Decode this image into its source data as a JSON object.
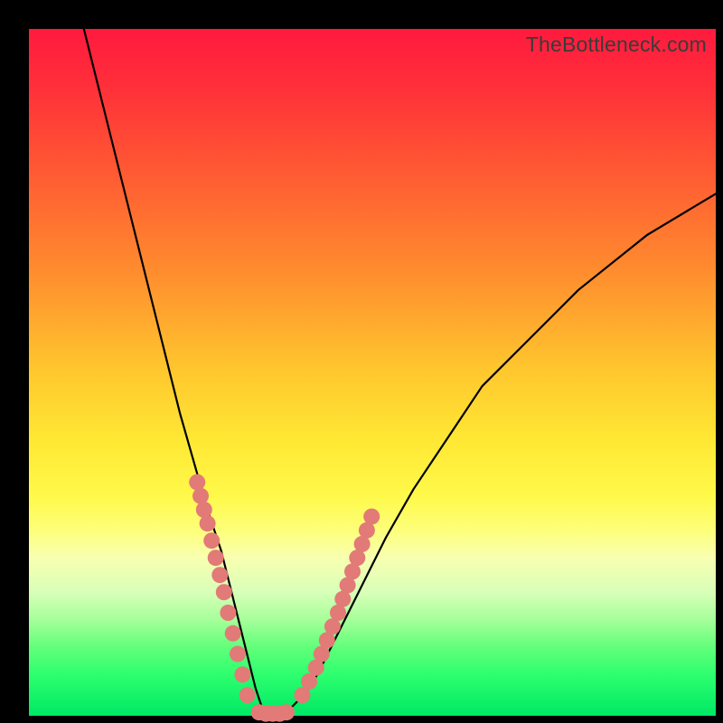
{
  "watermark": "TheBottleneck.com",
  "chart_data": {
    "type": "line",
    "title": "",
    "xlabel": "",
    "ylabel": "",
    "xlim": [
      0,
      100
    ],
    "ylim": [
      0,
      100
    ],
    "grid": false,
    "series": [
      {
        "name": "curve",
        "stroke": "#000000",
        "x": [
          8,
          10,
          12,
          14,
          16,
          18,
          20,
          22,
          24,
          26,
          27,
          28,
          29,
          30,
          31,
          32,
          33,
          34,
          35,
          36,
          37,
          38,
          40,
          42,
          44,
          46,
          48,
          52,
          56,
          60,
          66,
          72,
          80,
          90,
          100
        ],
        "y": [
          100,
          92,
          84,
          76,
          68,
          60,
          52,
          44,
          37,
          30,
          27,
          24,
          20,
          16,
          12,
          8,
          4,
          1,
          0,
          0,
          0,
          1,
          3,
          6,
          10,
          14,
          18,
          26,
          33,
          39,
          48,
          54,
          62,
          70,
          76
        ]
      },
      {
        "name": "good-zone-markers-left",
        "stroke": "#e27a77",
        "style": "dotted-thick",
        "x": [
          24.5,
          25,
          25.5,
          26,
          26.6,
          27.2,
          27.8,
          28.4,
          29,
          29.7,
          30.4,
          31.1,
          31.8
        ],
        "y": [
          34,
          32,
          30,
          28,
          25.5,
          23,
          20.5,
          18,
          15,
          12,
          9,
          6,
          3
        ]
      },
      {
        "name": "good-zone-markers-bottom",
        "stroke": "#e27a77",
        "style": "dotted-thick",
        "x": [
          33.5,
          34.5,
          35.5,
          36.5,
          37.5
        ],
        "y": [
          0.5,
          0.3,
          0.3,
          0.3,
          0.5
        ]
      },
      {
        "name": "good-zone-markers-right",
        "stroke": "#e27a77",
        "style": "dotted-thick",
        "x": [
          39.8,
          40.8,
          41.8,
          42.6,
          43.4,
          44.2,
          45,
          45.7,
          46.4,
          47.1,
          47.8,
          48.5,
          49.2,
          49.9
        ],
        "y": [
          3,
          5,
          7,
          9,
          11,
          13,
          15,
          17,
          19,
          21,
          23,
          25,
          27,
          29
        ]
      }
    ],
    "color_bands_note": "Background gradient encodes performance zones from red (top, bad) to green (bottom, good)"
  }
}
